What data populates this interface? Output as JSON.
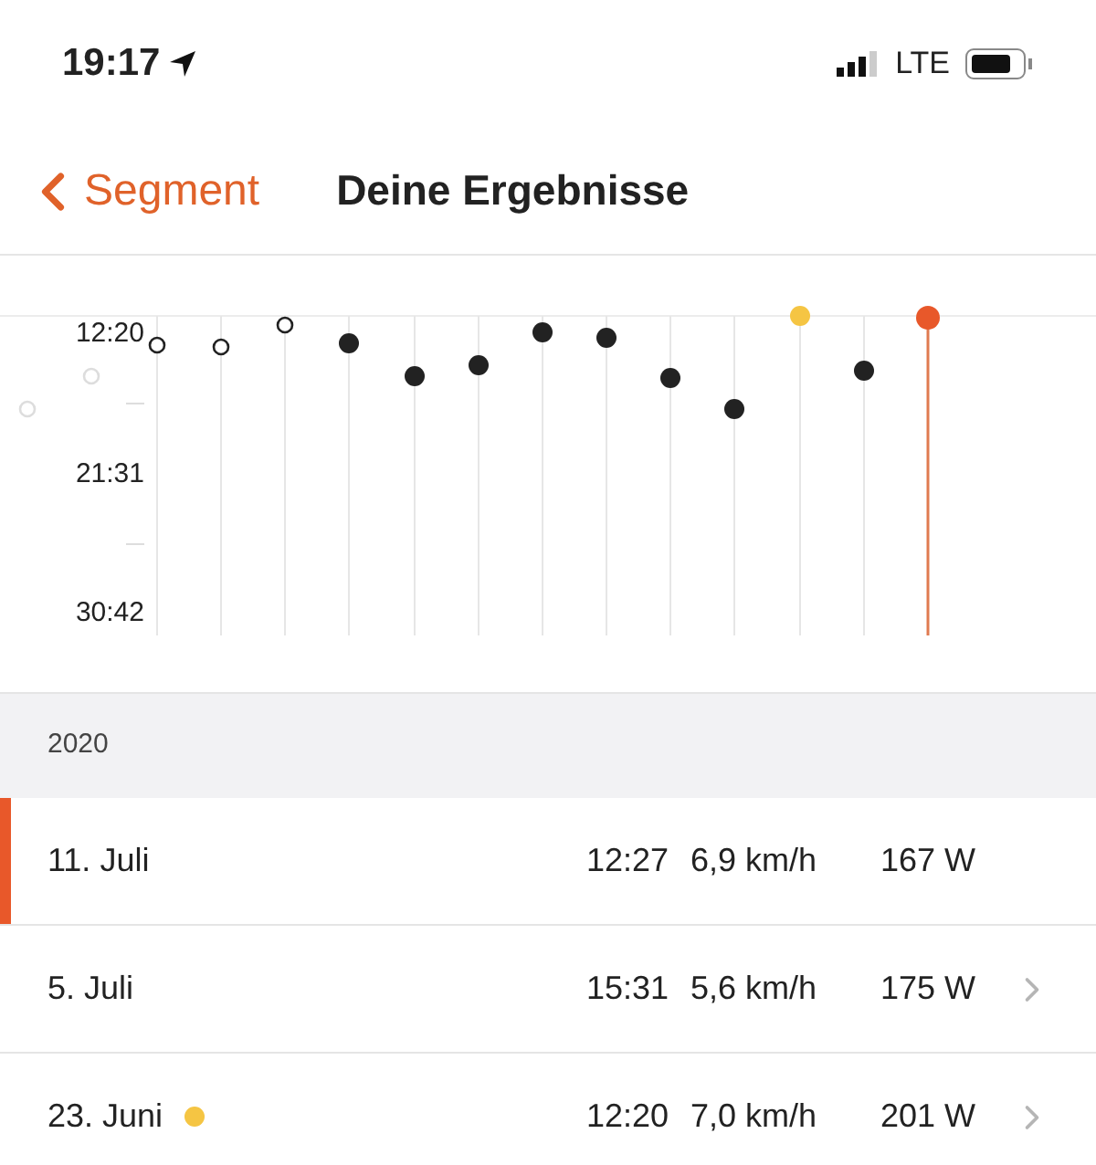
{
  "status_bar": {
    "time": "19:17",
    "network": "LTE"
  },
  "nav": {
    "back_label": "Segment",
    "title": "Deine Ergebnisse"
  },
  "chart": {
    "axis_labels": [
      "12:20",
      "21:31",
      "30:42"
    ]
  },
  "year": "2020",
  "rows": [
    {
      "date": "11. Juli",
      "time": "12:27",
      "speed": "6,9 km/h",
      "power": "167 W",
      "selected": true
    },
    {
      "date": "5. Juli",
      "time": "15:31",
      "speed": "5,6 km/h",
      "power": "175 W",
      "selected": false
    },
    {
      "date": "23. Juni",
      "color": "#f5c543",
      "time": "12:20",
      "speed": "7,0 km/h",
      "power": "201 W",
      "selected": false
    }
  ]
}
